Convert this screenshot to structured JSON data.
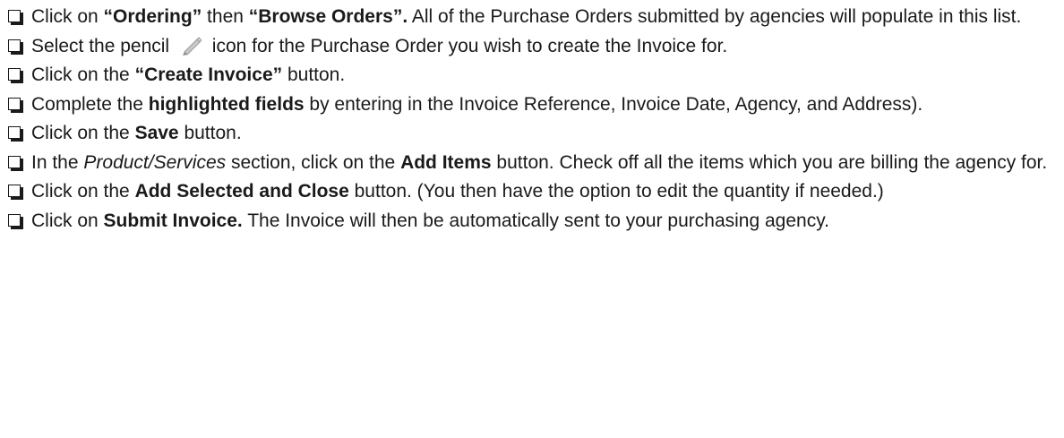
{
  "items": [
    {
      "parts": [
        {
          "t": "Click on "
        },
        {
          "t": "“Ordering”",
          "b": true
        },
        {
          "t": " then "
        },
        {
          "t": "“Browse Orders”.",
          "b": true
        },
        {
          "t": " All of the Purchase Orders submitted by agencies will populate in this list."
        }
      ]
    },
    {
      "parts": [
        {
          "t": "Select the pencil "
        },
        {
          "icon": "pencil-icon"
        },
        {
          "t": " icon for the Purchase Order you wish to create the Invoice for."
        }
      ]
    },
    {
      "parts": [
        {
          "t": "Click on the "
        },
        {
          "t": "“Create Invoice”",
          "b": true
        },
        {
          "t": " button."
        }
      ]
    },
    {
      "parts": [
        {
          "t": "Complete the "
        },
        {
          "t": "highlighted fields",
          "b": true
        },
        {
          "t": " by entering in the Invoice Reference, Invoice Date, Agency, and Address)."
        }
      ]
    },
    {
      "parts": [
        {
          "t": "Click on the "
        },
        {
          "t": "Save",
          "b": true
        },
        {
          "t": " button."
        }
      ]
    },
    {
      "parts": [
        {
          "t": "In the "
        },
        {
          "t": "Product/Services",
          "i": true
        },
        {
          "t": " section, click on the "
        },
        {
          "t": "Add Items",
          "b": true
        },
        {
          "t": " button. Check off all the items which you are billing the agency for."
        }
      ]
    },
    {
      "parts": [
        {
          "t": "Click on the "
        },
        {
          "t": "Add Selected and Close",
          "b": true
        },
        {
          "t": " button. (You then have the option to edit the quantity if needed.)"
        }
      ]
    },
    {
      "parts": [
        {
          "t": "Click on "
        },
        {
          "t": "Submit Invoice.",
          "b": true
        },
        {
          "t": " The Invoice will then be automatically sent to your purchasing agency."
        }
      ]
    }
  ]
}
